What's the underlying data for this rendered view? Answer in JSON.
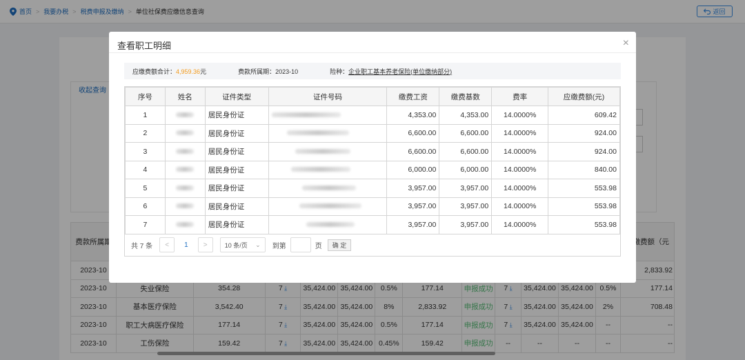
{
  "breadcrumb": {
    "items": [
      "首页",
      "我要办税",
      "税费申报及缴纳"
    ],
    "current": "单位社保费应缴信息查询"
  },
  "back_label": "返回",
  "background": {
    "collapse_label": "收起查询",
    "header_first": "费款所属期",
    "header_last": "应缴费额（元",
    "first_row_last": "2,833.92",
    "rows": [
      [
        "2023-10",
        "失业保险",
        "354.28",
        "7",
        "35,424.00",
        "35,424.00",
        "0.5%",
        "177.14",
        "申报成功",
        "7",
        "35,424.00",
        "35,424.00",
        "0.5%",
        "177.14"
      ],
      [
        "2023-10",
        "基本医疗保险",
        "3,542.40",
        "7",
        "35,424.00",
        "35,424.00",
        "8%",
        "2,833.92",
        "申报成功",
        "7",
        "35,424.00",
        "35,424.00",
        "2%",
        "708.48"
      ],
      [
        "2023-10",
        "职工大病医疗保险",
        "177.14",
        "7",
        "35,424.00",
        "35,424.00",
        "0.5%",
        "177.14",
        "申报成功",
        "7",
        "35,424.00",
        "35,424.00",
        "--",
        "--"
      ],
      [
        "2023-10",
        "工伤保险",
        "159.42",
        "7",
        "35,424.00",
        "35,424.00",
        "0.45%",
        "159.42",
        "申报成功",
        "--",
        "--",
        "--",
        "--",
        "--"
      ]
    ],
    "first_col_value": "2023-10"
  },
  "modal": {
    "title": "查看职工明细",
    "close_glyph": "×",
    "summary": {
      "total_label": "应缴费额合计：",
      "total_value": "4,959.36",
      "total_unit": "元",
      "period_label": "费款所属期：",
      "period_value": "2023-10",
      "insurance_label": "险种：",
      "insurance_value": "企业职工基本养老保险(单位缴纳部分)"
    },
    "columns": [
      "序号",
      "姓名",
      "证件类型",
      "证件号码",
      "缴费工资",
      "缴费基数",
      "费率",
      "应缴费额(元)"
    ],
    "rows": [
      {
        "no": "1",
        "id_type": "居民身份证",
        "wage": "4,353.00",
        "base": "4,353.00",
        "rate": "14.0000%",
        "amount": "609.42"
      },
      {
        "no": "2",
        "id_type": "居民身份证",
        "wage": "6,600.00",
        "base": "6,600.00",
        "rate": "14.0000%",
        "amount": "924.00"
      },
      {
        "no": "3",
        "id_type": "居民身份证",
        "wage": "6,600.00",
        "base": "6,600.00",
        "rate": "14.0000%",
        "amount": "924.00"
      },
      {
        "no": "4",
        "id_type": "居民身份证",
        "wage": "6,000.00",
        "base": "6,000.00",
        "rate": "14.0000%",
        "amount": "840.00"
      },
      {
        "no": "5",
        "id_type": "居民身份证",
        "wage": "3,957.00",
        "base": "3,957.00",
        "rate": "14.0000%",
        "amount": "553.98"
      },
      {
        "no": "6",
        "id_type": "居民身份证",
        "wage": "3,957.00",
        "base": "3,957.00",
        "rate": "14.0000%",
        "amount": "553.98"
      },
      {
        "no": "7",
        "id_type": "居民身份证",
        "wage": "3,957.00",
        "base": "3,957.00",
        "rate": "14.0000%",
        "amount": "553.98"
      }
    ],
    "pager": {
      "total_prefix": "共",
      "total_count": "7",
      "total_suffix": "条",
      "current_page": "1",
      "page_size": "10 条/页",
      "goto_label": "到第",
      "page_label": "页",
      "confirm_label": "确 定"
    }
  },
  "colors": {
    "accent": "#1f6fc1",
    "orange": "#f39b1c",
    "success": "#5bbf7a"
  }
}
